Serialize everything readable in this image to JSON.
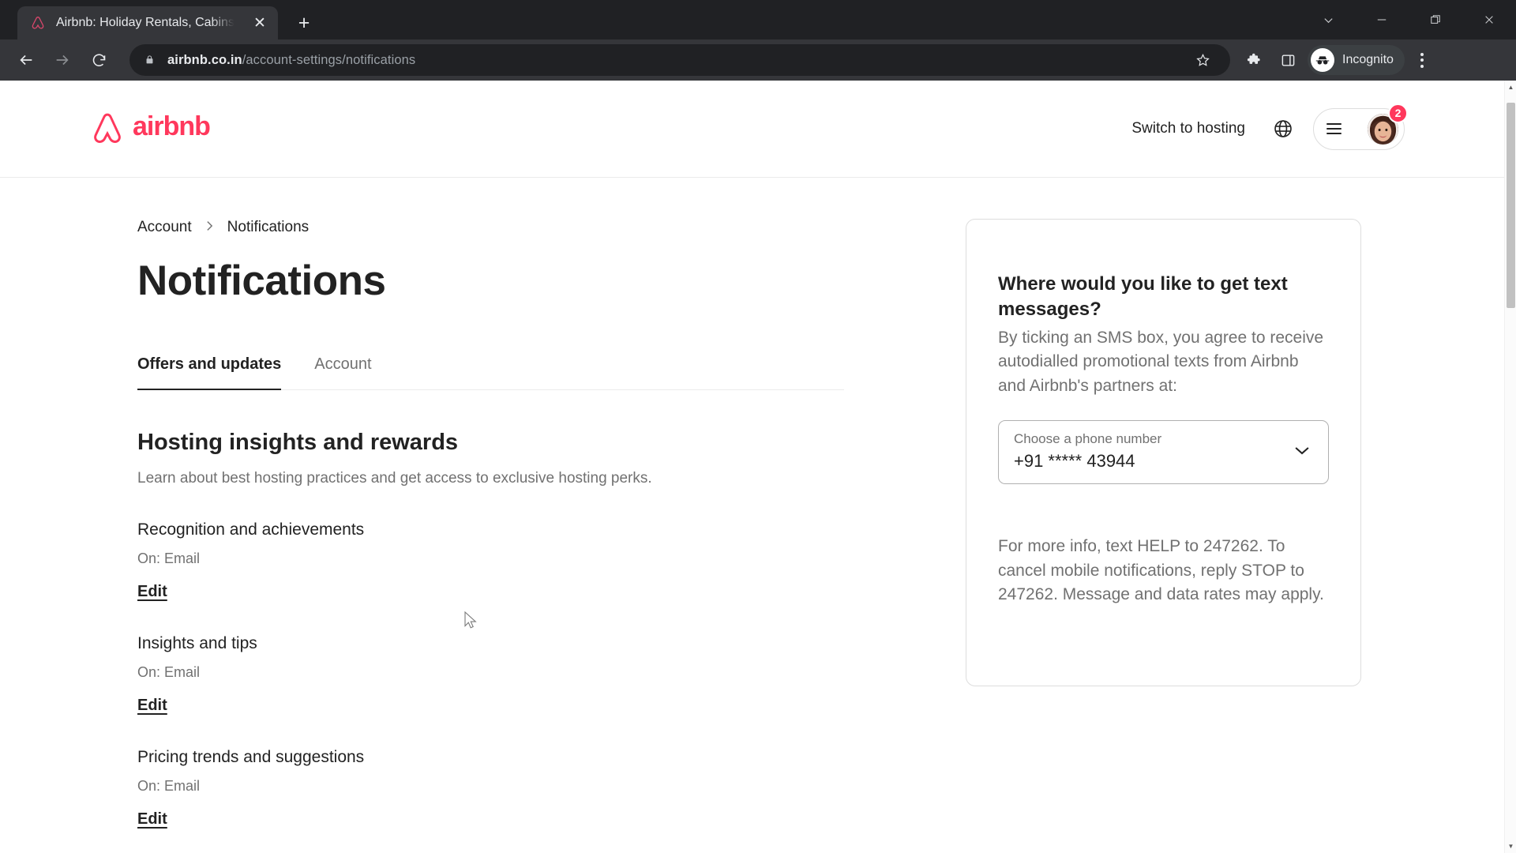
{
  "browser": {
    "tab": {
      "title": "Airbnb: Holiday Rentals, Cabins, B",
      "favicon_name": "airbnb-favicon",
      "close_label": "✕"
    },
    "new_tab_label": "+",
    "window_controls": {
      "more_label": "∨",
      "minimize_label": "—",
      "maximize_label": "❐",
      "close_label": "✕"
    },
    "nav": {
      "back_label": "←",
      "forward_label": "→",
      "reload_label": "⟳"
    },
    "omnibox": {
      "host": "airbnb.co.in",
      "path": "/account-settings/notifications",
      "lock_name": "lock-icon",
      "bookmark_label": "☆"
    },
    "toolbar": {
      "extensions_label": "🧩",
      "sidepanel_label": "▣",
      "incognito_label": "Incognito",
      "menu_label": "⋮"
    }
  },
  "site_header": {
    "logo_word": "airbnb",
    "switch_to_hosting": "Switch to hosting",
    "globe_name": "globe-icon",
    "menu_name": "hamburger-icon",
    "avatar_name": "user-avatar",
    "notification_badge": "2",
    "brand_color": "#FF385C"
  },
  "breadcrumb": {
    "items": [
      "Account",
      "Notifications"
    ],
    "separator": "›"
  },
  "page": {
    "title": "Notifications"
  },
  "tabs": [
    {
      "label": "Offers and updates",
      "active": true
    },
    {
      "label": "Account",
      "active": false
    }
  ],
  "section": {
    "title": "Hosting insights and rewards",
    "subtitle": "Learn about best hosting practices and get access to exclusive hosting perks."
  },
  "notifications": [
    {
      "name": "Recognition and achievements",
      "status": "On: Email",
      "edit": "Edit"
    },
    {
      "name": "Insights and tips",
      "status": "On: Email",
      "edit": "Edit"
    },
    {
      "name": "Pricing trends and suggestions",
      "status": "On: Email",
      "edit": "Edit"
    }
  ],
  "info_card": {
    "title": "Where would you like to get text messages?",
    "description": "By ticking an SMS box, you agree to receive autodialled promotional texts from Airbnb and Airbnb's partners at:",
    "select_label": "Choose a phone number",
    "select_value": "+91 ***** 43944",
    "chevron_name": "chevron-down-icon",
    "footer": "For more info, text HELP to 247262. To cancel mobile notifications, reply STOP to 247262. Message and data rates may apply."
  },
  "scrollbar": {
    "up_label": "▲",
    "down_label": "▼"
  }
}
